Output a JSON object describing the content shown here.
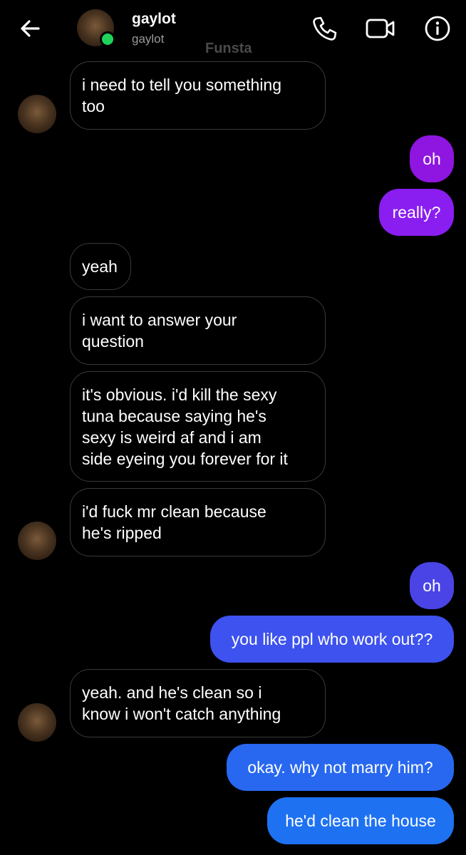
{
  "header": {
    "contact_name": "gaylot",
    "contact_username": "gaylot",
    "watermark": "Funsta",
    "icons": {
      "back": "arrow-left-icon",
      "call": "phone-icon",
      "video": "video-camera-icon",
      "info": "info-icon"
    },
    "online_color": "#1fd35a"
  },
  "messages": [
    {
      "dir": "in",
      "text": "i need to tell you something\ntoo"
    },
    {
      "dir": "out",
      "text": "oh",
      "color": "#8f15e0"
    },
    {
      "dir": "out",
      "text": "really?",
      "color": "#8a1df0"
    },
    {
      "dir": "in",
      "text": "yeah"
    },
    {
      "dir": "in",
      "text": "i want to answer your\nquestion"
    },
    {
      "dir": "in",
      "text": "it's obvious. i'd kill the sexy\ntuna because saying he's\nsexy is weird af and i am\nside eyeing you forever for it"
    },
    {
      "dir": "in",
      "text": "i'd fuck mr clean because\nhe's ripped"
    },
    {
      "dir": "out",
      "text": "oh",
      "color": "#4a44e6"
    },
    {
      "dir": "out",
      "text": "you like ppl who work out??",
      "color": "#3d52ee"
    },
    {
      "dir": "in",
      "text": "yeah. and he's clean so i\nknow i won't catch anything"
    },
    {
      "dir": "out",
      "text": "okay. why not marry him?",
      "color": "#2868f0"
    },
    {
      "dir": "out",
      "text": "he'd clean the house",
      "color": "#1e72f2"
    }
  ]
}
